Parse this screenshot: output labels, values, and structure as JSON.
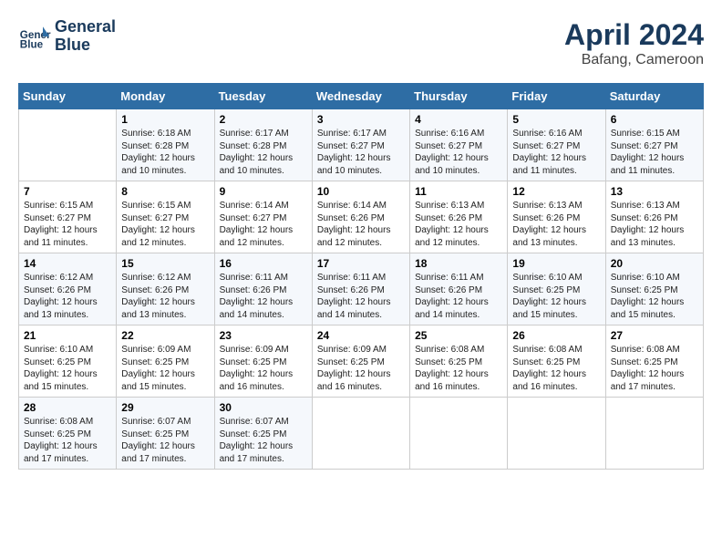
{
  "header": {
    "logo_line1": "General",
    "logo_line2": "Blue",
    "title": "April 2024",
    "subtitle": "Bafang, Cameroon"
  },
  "columns": [
    "Sunday",
    "Monday",
    "Tuesday",
    "Wednesday",
    "Thursday",
    "Friday",
    "Saturday"
  ],
  "weeks": [
    [
      {
        "day": "",
        "info": ""
      },
      {
        "day": "1",
        "info": "Sunrise: 6:18 AM\nSunset: 6:28 PM\nDaylight: 12 hours\nand 10 minutes."
      },
      {
        "day": "2",
        "info": "Sunrise: 6:17 AM\nSunset: 6:28 PM\nDaylight: 12 hours\nand 10 minutes."
      },
      {
        "day": "3",
        "info": "Sunrise: 6:17 AM\nSunset: 6:27 PM\nDaylight: 12 hours\nand 10 minutes."
      },
      {
        "day": "4",
        "info": "Sunrise: 6:16 AM\nSunset: 6:27 PM\nDaylight: 12 hours\nand 10 minutes."
      },
      {
        "day": "5",
        "info": "Sunrise: 6:16 AM\nSunset: 6:27 PM\nDaylight: 12 hours\nand 11 minutes."
      },
      {
        "day": "6",
        "info": "Sunrise: 6:15 AM\nSunset: 6:27 PM\nDaylight: 12 hours\nand 11 minutes."
      }
    ],
    [
      {
        "day": "7",
        "info": "Sunrise: 6:15 AM\nSunset: 6:27 PM\nDaylight: 12 hours\nand 11 minutes."
      },
      {
        "day": "8",
        "info": "Sunrise: 6:15 AM\nSunset: 6:27 PM\nDaylight: 12 hours\nand 12 minutes."
      },
      {
        "day": "9",
        "info": "Sunrise: 6:14 AM\nSunset: 6:27 PM\nDaylight: 12 hours\nand 12 minutes."
      },
      {
        "day": "10",
        "info": "Sunrise: 6:14 AM\nSunset: 6:26 PM\nDaylight: 12 hours\nand 12 minutes."
      },
      {
        "day": "11",
        "info": "Sunrise: 6:13 AM\nSunset: 6:26 PM\nDaylight: 12 hours\nand 12 minutes."
      },
      {
        "day": "12",
        "info": "Sunrise: 6:13 AM\nSunset: 6:26 PM\nDaylight: 12 hours\nand 13 minutes."
      },
      {
        "day": "13",
        "info": "Sunrise: 6:13 AM\nSunset: 6:26 PM\nDaylight: 12 hours\nand 13 minutes."
      }
    ],
    [
      {
        "day": "14",
        "info": "Sunrise: 6:12 AM\nSunset: 6:26 PM\nDaylight: 12 hours\nand 13 minutes."
      },
      {
        "day": "15",
        "info": "Sunrise: 6:12 AM\nSunset: 6:26 PM\nDaylight: 12 hours\nand 13 minutes."
      },
      {
        "day": "16",
        "info": "Sunrise: 6:11 AM\nSunset: 6:26 PM\nDaylight: 12 hours\nand 14 minutes."
      },
      {
        "day": "17",
        "info": "Sunrise: 6:11 AM\nSunset: 6:26 PM\nDaylight: 12 hours\nand 14 minutes."
      },
      {
        "day": "18",
        "info": "Sunrise: 6:11 AM\nSunset: 6:26 PM\nDaylight: 12 hours\nand 14 minutes."
      },
      {
        "day": "19",
        "info": "Sunrise: 6:10 AM\nSunset: 6:25 PM\nDaylight: 12 hours\nand 15 minutes."
      },
      {
        "day": "20",
        "info": "Sunrise: 6:10 AM\nSunset: 6:25 PM\nDaylight: 12 hours\nand 15 minutes."
      }
    ],
    [
      {
        "day": "21",
        "info": "Sunrise: 6:10 AM\nSunset: 6:25 PM\nDaylight: 12 hours\nand 15 minutes."
      },
      {
        "day": "22",
        "info": "Sunrise: 6:09 AM\nSunset: 6:25 PM\nDaylight: 12 hours\nand 15 minutes."
      },
      {
        "day": "23",
        "info": "Sunrise: 6:09 AM\nSunset: 6:25 PM\nDaylight: 12 hours\nand 16 minutes."
      },
      {
        "day": "24",
        "info": "Sunrise: 6:09 AM\nSunset: 6:25 PM\nDaylight: 12 hours\nand 16 minutes."
      },
      {
        "day": "25",
        "info": "Sunrise: 6:08 AM\nSunset: 6:25 PM\nDaylight: 12 hours\nand 16 minutes."
      },
      {
        "day": "26",
        "info": "Sunrise: 6:08 AM\nSunset: 6:25 PM\nDaylight: 12 hours\nand 16 minutes."
      },
      {
        "day": "27",
        "info": "Sunrise: 6:08 AM\nSunset: 6:25 PM\nDaylight: 12 hours\nand 17 minutes."
      }
    ],
    [
      {
        "day": "28",
        "info": "Sunrise: 6:08 AM\nSunset: 6:25 PM\nDaylight: 12 hours\nand 17 minutes."
      },
      {
        "day": "29",
        "info": "Sunrise: 6:07 AM\nSunset: 6:25 PM\nDaylight: 12 hours\nand 17 minutes."
      },
      {
        "day": "30",
        "info": "Sunrise: 6:07 AM\nSunset: 6:25 PM\nDaylight: 12 hours\nand 17 minutes."
      },
      {
        "day": "",
        "info": ""
      },
      {
        "day": "",
        "info": ""
      },
      {
        "day": "",
        "info": ""
      },
      {
        "day": "",
        "info": ""
      }
    ]
  ]
}
